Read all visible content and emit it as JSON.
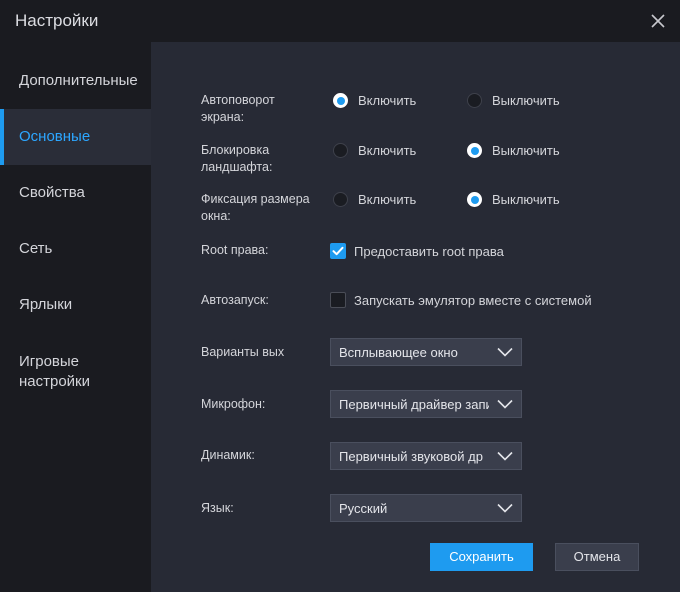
{
  "window": {
    "title": "Настройки"
  },
  "sidebar": {
    "items": [
      {
        "label": "Дополнительные",
        "active": false
      },
      {
        "label": "Основные",
        "active": true
      },
      {
        "label": "Свойства",
        "active": false
      },
      {
        "label": "Сеть",
        "active": false
      },
      {
        "label": "Ярлыки",
        "active": false
      },
      {
        "label": "Игровые настройки",
        "active": false
      }
    ]
  },
  "settings": {
    "autorotate": {
      "label": "Автоповорот экрана:",
      "options": [
        "Включить",
        "Выключить"
      ],
      "selected": "Включить"
    },
    "landscape_lock": {
      "label": "Блокировка ландшафта:",
      "options": [
        "Включить",
        "Выключить"
      ],
      "selected": "Выключить"
    },
    "fix_size": {
      "label": "Фиксация размера окна:",
      "options": [
        "Включить",
        "Выключить"
      ],
      "selected": "Выключить"
    },
    "root": {
      "label": "Root права:",
      "checkbox_label": "Предоставить root права",
      "checked": true
    },
    "autostart": {
      "label": "Автозапуск:",
      "checkbox_label": "Запускать эмулятор вместе с системой",
      "checked": false
    },
    "exit_variants": {
      "label": "Варианты вых",
      "value": "Всплывающее окно"
    },
    "microphone": {
      "label": "Микрофон:",
      "value": "Первичный драйвер запи"
    },
    "speaker": {
      "label": "Динамик:",
      "value": "Первичный звуковой др"
    },
    "language": {
      "label": "Язык:",
      "value": "Русский"
    }
  },
  "buttons": {
    "save": "Сохранить",
    "cancel": "Отмена"
  },
  "colors": {
    "accent": "#1e9bf0",
    "panel": "#272a35",
    "sidebar": "#1a1b20"
  },
  "icons": {
    "close": "close-icon",
    "dropdown": "chevron-down-icon",
    "check": "checkmark-icon"
  }
}
